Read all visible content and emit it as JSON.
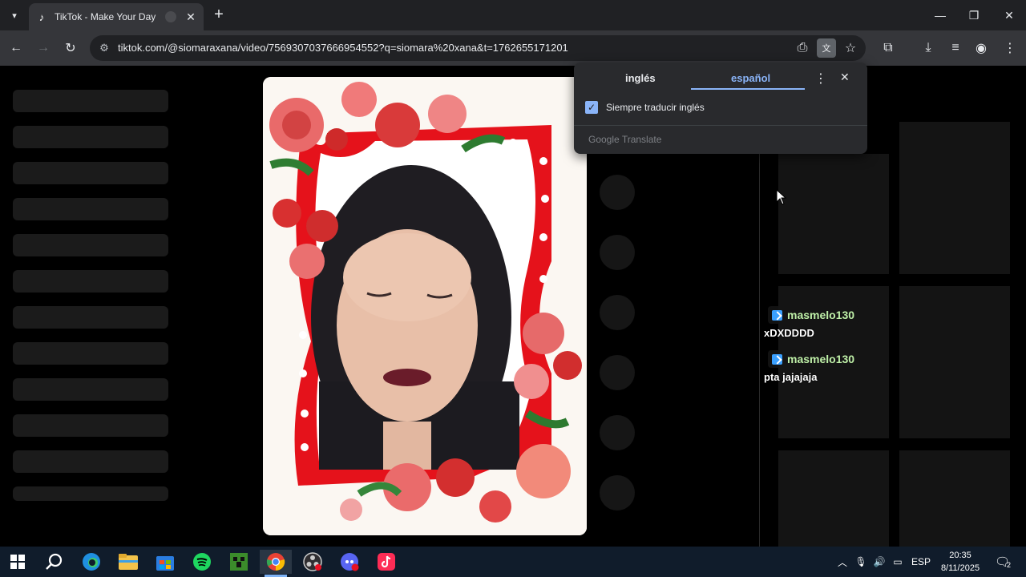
{
  "browser": {
    "tab_title": "TikTok - Make Your Day",
    "tab_favicon": "tiktok-icon",
    "new_tab": "+",
    "url_host": "tiktok.com",
    "url_path": "/@siomaraxana/video/7569307037666954552?q=siomara%20xana&t=1762655171201"
  },
  "translate_popup": {
    "tab_source": "inglés",
    "tab_target": "español",
    "always_translate_label": "Siempre traducir inglés",
    "always_translate_checked": true,
    "footer": "Google Translate"
  },
  "chat": [
    {
      "user": "masmelo130",
      "message": "xDXDDDD"
    },
    {
      "user": "masmelo130",
      "message": "pta jajajaja"
    }
  ],
  "taskbar": {
    "apps": [
      "windows-start-icon",
      "search-icon",
      "edge-icon",
      "file-explorer-icon",
      "microsoft-store-icon",
      "spotify-icon",
      "minecraft-icon",
      "chrome-icon",
      "obs-icon",
      "discord-icon",
      "tiktok-icon"
    ],
    "language": "ESP",
    "time": "20:35",
    "date": "8/11/2025",
    "notifications_count": "2"
  }
}
